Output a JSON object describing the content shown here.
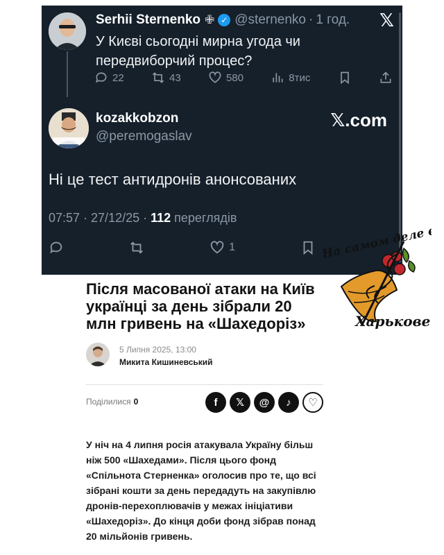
{
  "tweet1": {
    "name": "Serhii Sternenko",
    "cross": "✙",
    "handle": "@sternenko",
    "time": "1 год.",
    "text": "У Києві сьогодні мирна угода чи передвиборчий процес?",
    "replies": "22",
    "retweets": "43",
    "likes": "580",
    "views": "8тис"
  },
  "tweet2": {
    "name": "kozakkobzon",
    "handle": "@peremogaslav",
    "brand": "𝕏.com",
    "text": "Ні це тест антидронів анонсованих",
    "timestamp": "07:57 · 27/12/25 · ",
    "views_count": "112",
    "views_label": " переглядів",
    "likes": "1"
  },
  "logo": {
    "top_text": "На самом деле в",
    "bottom_text": "Харькове"
  },
  "article": {
    "headline": "Після масованої атаки на Київ українці за день зібрали 20 млн гривень на «Шахедоріз»",
    "date": "5 Липня 2025, 13:00",
    "author": "Микита Кишиневський",
    "shared_label": "Поділилися",
    "shared_count": "0",
    "body": "У ніч на 4 липня росія атакувала Україну більш ніж 500 «Шахедами». Після цього фонд «Спільнота Стерненка» оголосив про те, що всі зібрані кошти за день передадуть на закупівлю дронів-перехоплювачів у межах ініціативи «Шахедоріз». До кінця доби фонд зібрав понад 20 мільйонів гривень."
  }
}
